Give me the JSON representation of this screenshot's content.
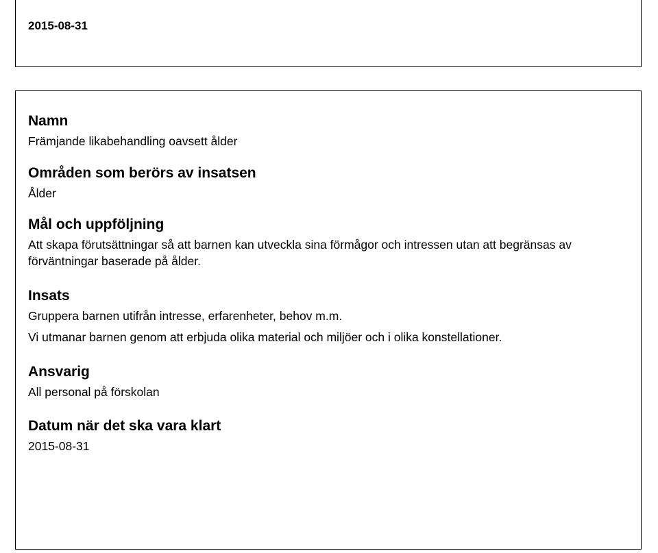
{
  "top_date": "2015-08-31",
  "sections": {
    "namn": {
      "heading": "Namn",
      "text": "Främjande likabehandling oavsett ålder"
    },
    "omraden": {
      "heading": "Områden som berörs av insatsen",
      "text": "Ålder"
    },
    "mal": {
      "heading": "Mål och uppföljning",
      "text": "Att skapa förutsättningar så att barnen kan utveckla sina förmågor och intressen utan att begränsas av förväntningar baserade på ålder."
    },
    "insats": {
      "heading": "Insats",
      "line1": "Gruppera barnen utifrån intresse, erfarenheter, behov m.m.",
      "line2": "Vi utmanar barnen genom att erbjuda olika material och miljöer och i olika konstellationer."
    },
    "ansvarig": {
      "heading": "Ansvarig",
      "text": "All personal på förskolan"
    },
    "datum_klart": {
      "heading": "Datum när det ska vara klart",
      "text": "2015-08-31"
    }
  }
}
